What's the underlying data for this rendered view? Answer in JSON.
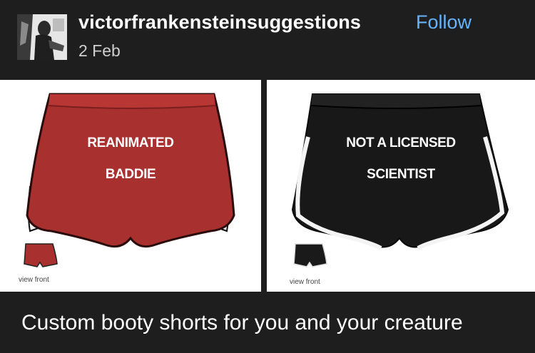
{
  "post": {
    "username": "victorfrankensteinsuggestions",
    "follow_label": "Follow",
    "date": "2 Feb",
    "caption": "Custom booty shorts for you and your creature"
  },
  "images": [
    {
      "line1": "REANIMATED",
      "line2": "BADDIE",
      "thumb_label": "view front",
      "color": "#a8302e"
    },
    {
      "line1": "NOT A LICENSED",
      "line2": "SCIENTIST",
      "thumb_label": "view front",
      "color": "#1a1a1a"
    }
  ],
  "colors": {
    "background": "#1e1e1e",
    "follow": "#64b4ff"
  }
}
